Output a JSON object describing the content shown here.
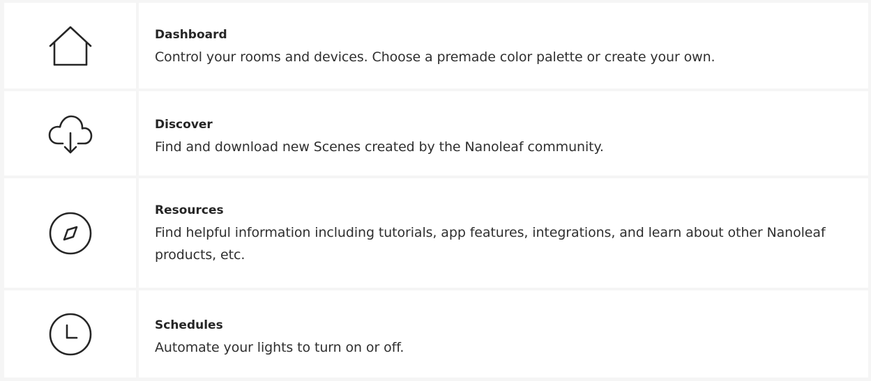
{
  "items": [
    {
      "icon": "home-icon",
      "title": "Dashboard",
      "description": "Control your rooms and devices. Choose a premade color palette or create your own."
    },
    {
      "icon": "cloud-download-icon",
      "title": "Discover",
      "description": "Find and download new Scenes created by the Nanoleaf community."
    },
    {
      "icon": "compass-icon",
      "title": "Resources",
      "description": "Find helpful information including tutorials, app features, integrations, and learn about other Nanoleaf products, etc."
    },
    {
      "icon": "clock-icon",
      "title": "Schedules",
      "description": "Automate your lights to turn on or off."
    }
  ],
  "colors": {
    "text": "#262626",
    "border": "#f5f5f5",
    "background": "#ffffff"
  }
}
